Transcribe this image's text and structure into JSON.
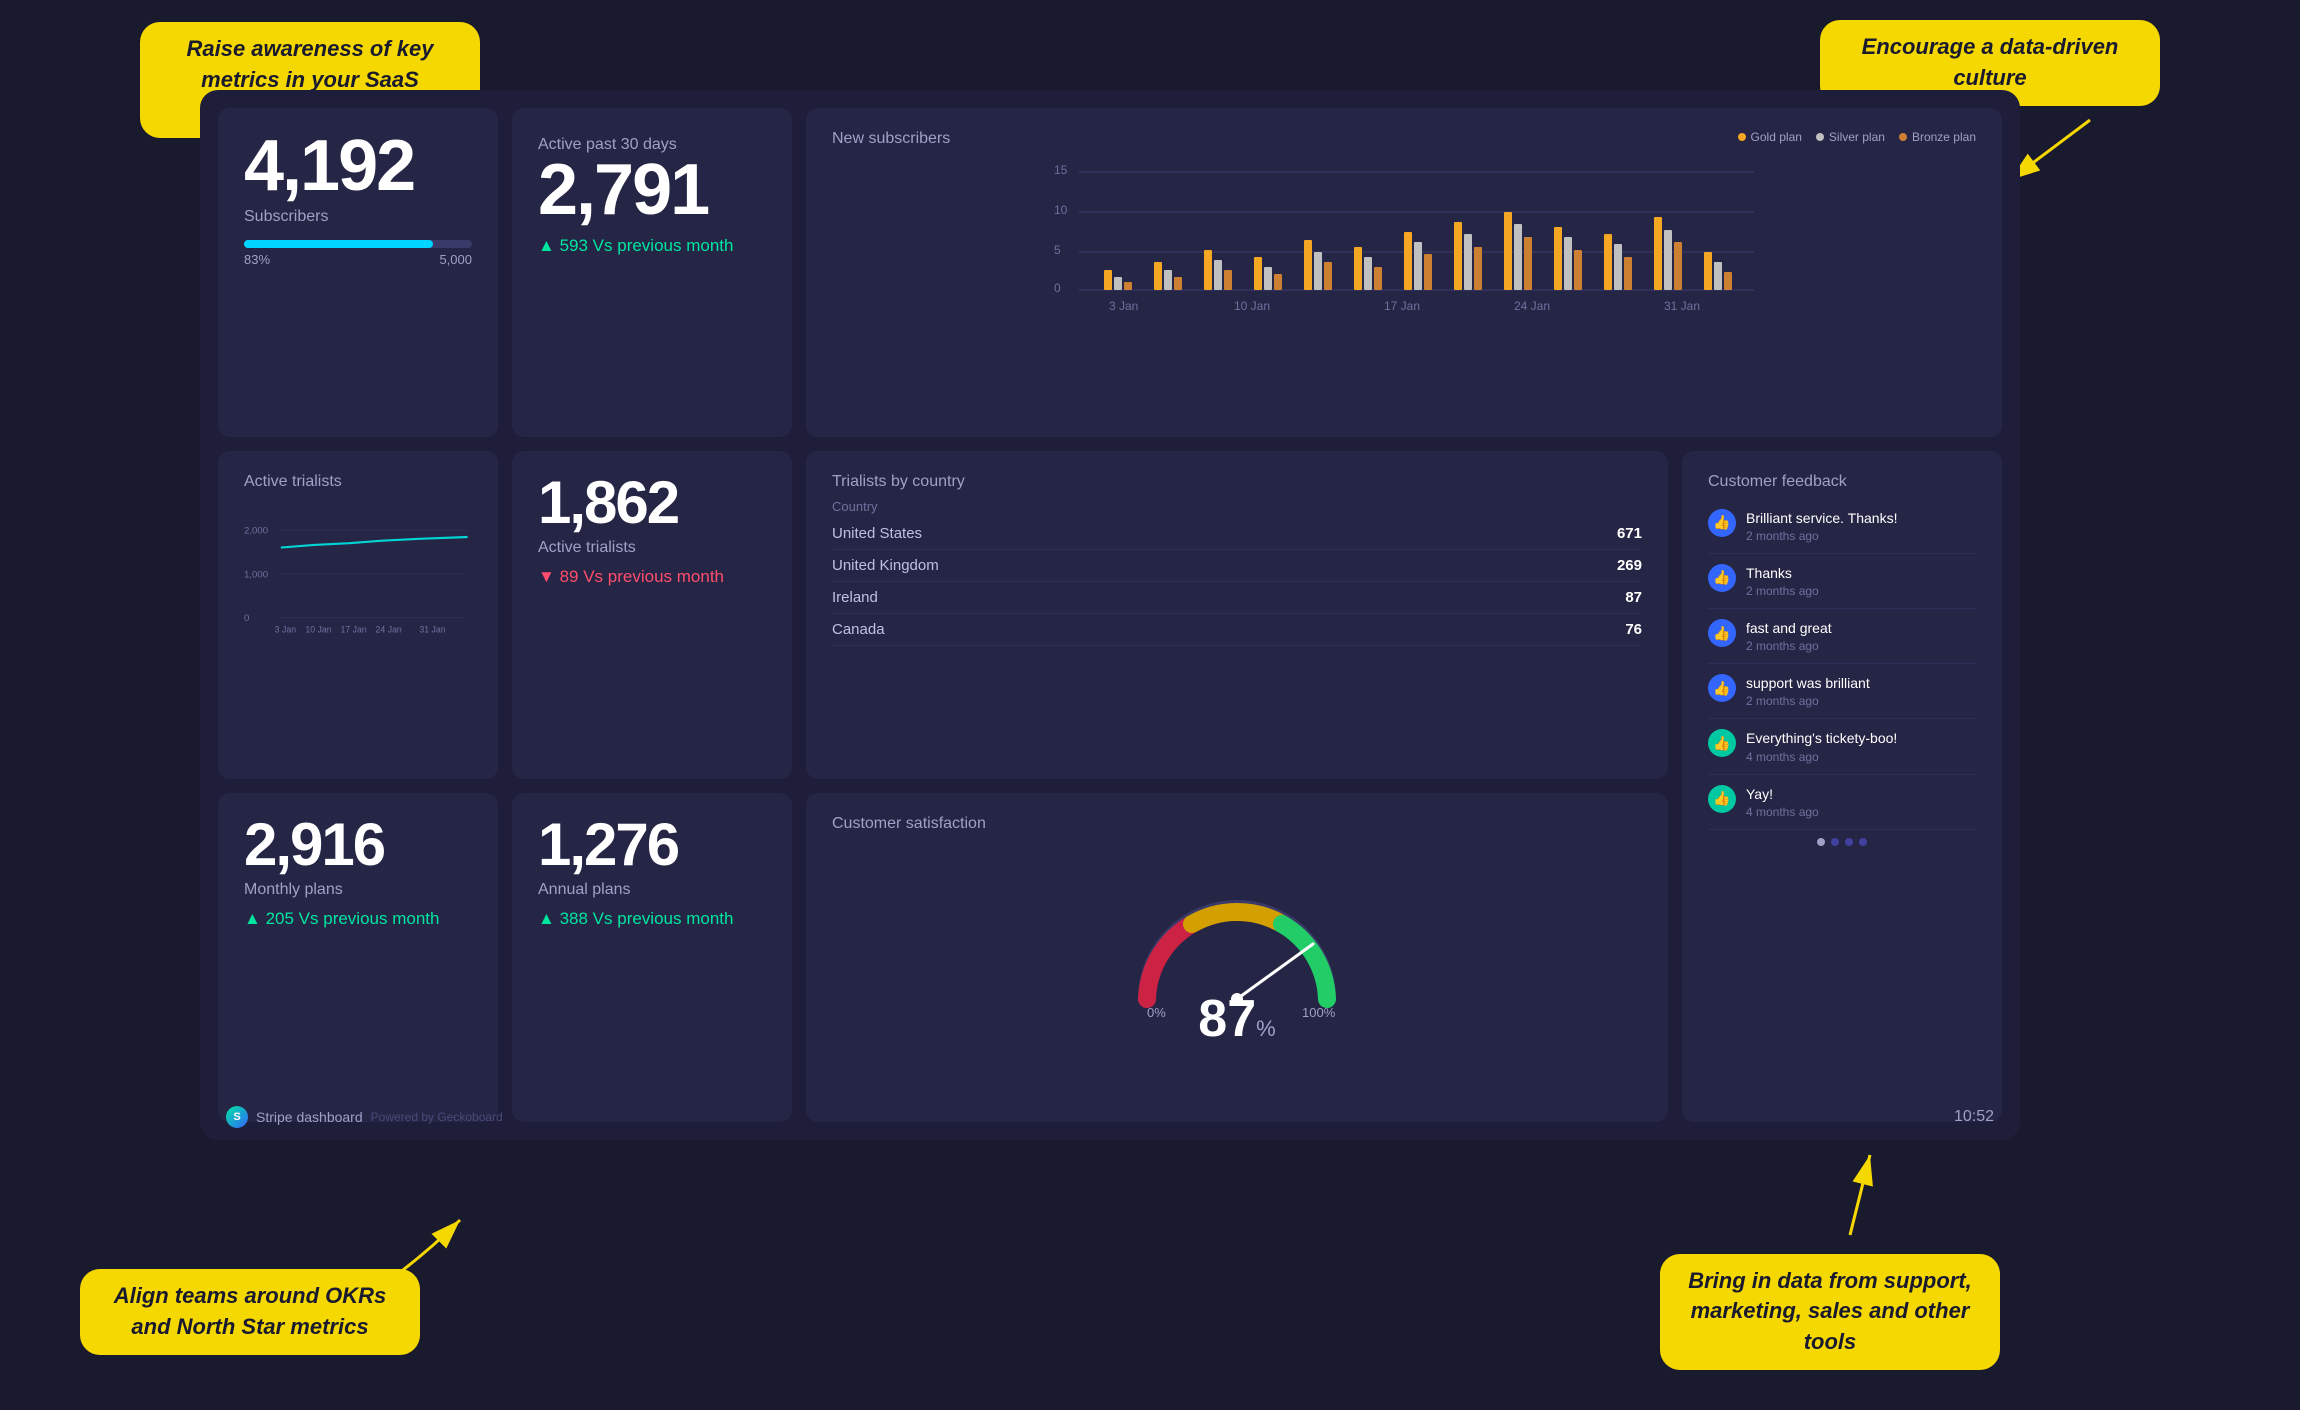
{
  "annotations": {
    "top_left": "Raise awareness of key metrics in your SaaS business",
    "top_right": "Encourage a data-driven culture",
    "bottom_left": "Align teams around OKRs and North Star metrics",
    "bottom_right": "Bring in data from support, marketing, sales and other tools"
  },
  "footer": {
    "brand": "Stripe dashboard",
    "powered_by": "Powered by Geckoboard",
    "time": "10:52"
  },
  "cards": {
    "subscribers": {
      "title": "Subscribers",
      "value": "4,192",
      "progress_pct": "83%",
      "progress_max": "5,000"
    },
    "active_users": {
      "title": "Active past 30 days",
      "value": "2,791",
      "change": "593",
      "change_label": "Vs previous month",
      "direction": "up"
    },
    "new_subscribers": {
      "title": "New subscribers",
      "legend": [
        "Gold plan",
        "Silver plan",
        "Bronze plan"
      ],
      "x_labels": [
        "3 Jan",
        "10 Jan",
        "17 Jan",
        "24 Jan",
        "31 Jan"
      ],
      "y_labels": [
        "15",
        "10",
        "5",
        "0"
      ]
    },
    "active_trialists_chart": {
      "title": "Active trialists",
      "y_labels": [
        "2,000",
        "1,000",
        "0"
      ],
      "x_labels": [
        "3 Jan",
        "10 Jan",
        "17 Jan",
        "24 Jan",
        "31 Jan"
      ]
    },
    "active_trialists_number": {
      "title": "Active trialists",
      "value": "1,862",
      "change": "89",
      "change_label": "Vs previous month",
      "direction": "down"
    },
    "trialists_country": {
      "title": "Trialists by country",
      "column_label": "Country",
      "rows": [
        {
          "country": "United States",
          "count": "671"
        },
        {
          "country": "United Kingdom",
          "count": "269"
        },
        {
          "country": "Ireland",
          "count": "87"
        },
        {
          "country": "Canada",
          "count": "76"
        }
      ]
    },
    "customer_feedback": {
      "title": "Customer feedback",
      "items": [
        {
          "text": "Brilliant service. Thanks!",
          "time": "2 months ago",
          "type": "blue"
        },
        {
          "text": "Thanks",
          "time": "2 months ago",
          "type": "blue"
        },
        {
          "text": "fast and great",
          "time": "2 months ago",
          "type": "blue"
        },
        {
          "text": "support was brilliant",
          "time": "2 months ago",
          "type": "blue"
        },
        {
          "text": "Everything's tickety-boo!",
          "time": "4 months ago",
          "type": "teal"
        },
        {
          "text": "Yay!",
          "time": "4 months ago",
          "type": "teal"
        }
      ],
      "dots": [
        true,
        false,
        false,
        false
      ]
    },
    "monthly_plans": {
      "title": "Monthly plans",
      "value": "2,916",
      "change": "205",
      "change_label": "Vs previous month",
      "direction": "up"
    },
    "annual_plans": {
      "title": "Annual plans",
      "value": "1,276",
      "change": "388",
      "change_label": "Vs previous month",
      "direction": "up"
    },
    "satisfaction": {
      "title": "Customer satisfaction",
      "value": "87",
      "unit": "%",
      "gauge_min": "0%",
      "gauge_max": "100%"
    }
  }
}
